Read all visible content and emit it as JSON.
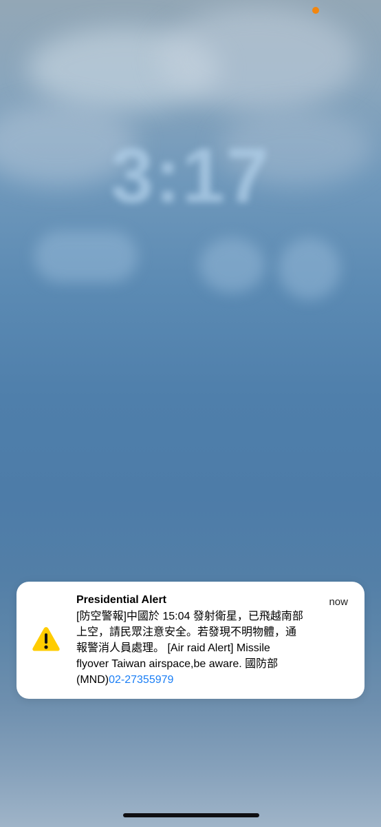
{
  "status_bar": {
    "privacy_indicator_color": "#f2860f"
  },
  "lock_screen": {
    "time": "3:17"
  },
  "notification": {
    "icon": "warning-triangle-icon",
    "title": "Presidential Alert",
    "timestamp": "now",
    "message_line1": "[防空警報]中國於 15:04 發射衛星，已飛越南部",
    "message_line2": "上空，請民眾注意安全。若發現不明物體，通",
    "message_line3": "報警消人員處理。 [Air raid Alert] Missile",
    "message_line4": "flyover Taiwan airspace,be aware. 國防部",
    "message_line5_prefix": " (MND)",
    "phone_number": "02-27355979",
    "link_color": "#1a7ef5"
  }
}
